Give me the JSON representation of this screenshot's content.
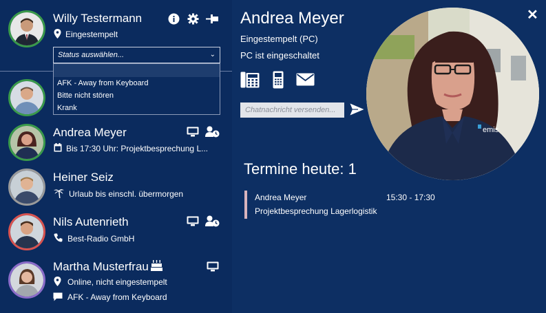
{
  "me": {
    "name": "Willy Testermann",
    "location": "Eingestempelt",
    "status_select": {
      "placeholder": "Status auswählen..."
    },
    "status_options": [
      "AFK - Away from Keyboard",
      "Bitte nicht stören",
      "Krank"
    ]
  },
  "contacts": [
    {
      "name": "",
      "ring": "#3a9a4a"
    },
    {
      "name": "Andrea Meyer",
      "line1": "Bis 17:30 Uhr: Projektbesprechung L...",
      "ring": "#3a9a4a"
    },
    {
      "name": "Heiner Seiz",
      "line1": "Urlaub bis einschl. übermorgen",
      "ring": "#9a9a9a"
    },
    {
      "name": "Nils Autenrieth",
      "line1": "Best-Radio GmbH",
      "ring": "#d9534f"
    },
    {
      "name": "Martha Musterfrau",
      "line1": "Online, nicht eingestempelt",
      "line2": "AFK - Away from Keyboard",
      "ring": "#8b6cc9"
    }
  ],
  "detail": {
    "name": "Andrea Meyer",
    "status": "Eingestempelt (PC)",
    "pc_state": "PC ist eingeschaltet",
    "chat_placeholder": "Chatnachricht versenden...",
    "close_label": "✕",
    "appointments_title": "Termine heute: 1",
    "appointment": {
      "person": "Andrea Meyer",
      "time": "15:30 - 17:30",
      "subject": "Projektbesprechung Lagerlogistik"
    },
    "photo_logo": "emis"
  },
  "colors": {
    "background": "#0b2b5e",
    "panel": "#0d2f63",
    "ring_green": "#3a9a4a",
    "ring_red": "#d9534f",
    "ring_purple": "#8b6cc9",
    "appointment_bar": "#d8b4bd"
  },
  "icons": [
    "info-icon",
    "gear-icon",
    "pin-icon",
    "location-icon",
    "calendar-icon",
    "palm-tree-icon",
    "phone-icon",
    "chat-bubble-icon",
    "monitor-icon",
    "user-clock-icon",
    "birthday-cake-icon",
    "desk-phone-icon",
    "mobile-phone-icon",
    "email-icon",
    "send-icon",
    "close-icon"
  ]
}
